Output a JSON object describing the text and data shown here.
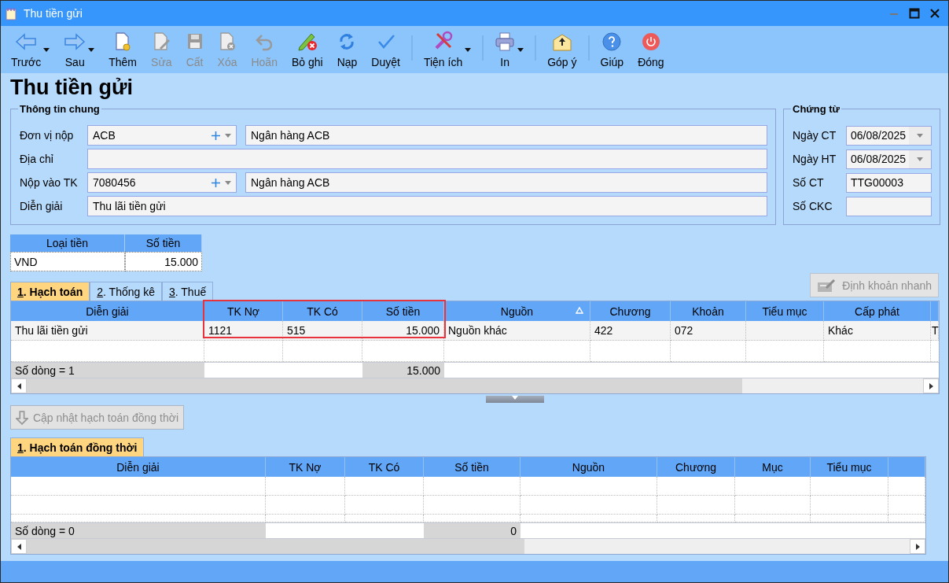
{
  "window": {
    "title": "Thu tiền gửi"
  },
  "toolbar": [
    {
      "kind": "button",
      "label": "Trước",
      "disabled": false,
      "dropdown": true
    },
    {
      "kind": "button",
      "label": "Sau",
      "disabled": false,
      "dropdown": true
    },
    {
      "kind": "button",
      "label": "Thêm",
      "disabled": false,
      "dropdown": false
    },
    {
      "kind": "button",
      "label": "Sửa",
      "disabled": true,
      "dropdown": false
    },
    {
      "kind": "button",
      "label": "Cất",
      "disabled": true,
      "dropdown": false
    },
    {
      "kind": "button",
      "label": "Xóa",
      "disabled": true,
      "dropdown": false
    },
    {
      "kind": "button",
      "label": "Hoãn",
      "disabled": true,
      "dropdown": false
    },
    {
      "kind": "button",
      "label": "Bỏ ghi",
      "disabled": false,
      "dropdown": false
    },
    {
      "kind": "button",
      "label": "Nạp",
      "disabled": false,
      "dropdown": false
    },
    {
      "kind": "button",
      "label": "Duyệt",
      "disabled": false,
      "dropdown": false
    },
    {
      "kind": "separator"
    },
    {
      "kind": "button",
      "label": "Tiện ích",
      "disabled": false,
      "dropdown": true
    },
    {
      "kind": "separator"
    },
    {
      "kind": "button",
      "label": "In",
      "disabled": false,
      "dropdown": true
    },
    {
      "kind": "separator"
    },
    {
      "kind": "button",
      "label": "Góp ý",
      "disabled": false,
      "dropdown": false
    },
    {
      "kind": "separator"
    },
    {
      "kind": "button",
      "label": "Giúp",
      "disabled": false,
      "dropdown": false
    },
    {
      "kind": "button",
      "label": "Đóng",
      "disabled": false,
      "dropdown": false
    }
  ],
  "heading": "Thu tiền gửi",
  "general_info": {
    "legend": "Thông tin chung",
    "fields": [
      {
        "kind": "combo",
        "label": "Đơn vị nộp",
        "value": "ACB",
        "name": "Ngân hàng ACB"
      },
      {
        "kind": "text",
        "label": "Địa chỉ"
      },
      {
        "kind": "combo",
        "label": "Nộp vào TK",
        "value": "7080456",
        "name": "Ngân hàng ACB"
      },
      {
        "kind": "text",
        "label": "Diễn giải",
        "value": "Thu lãi tiền gửi"
      }
    ]
  },
  "voucher": {
    "legend": "Chứng từ",
    "fields": [
      {
        "kind": "date",
        "label": "Ngày CT",
        "value": "06/08/2025"
      },
      {
        "kind": "date",
        "label": "Ngày HT",
        "value": "06/08/2025"
      },
      {
        "kind": "text",
        "label": "Số CT",
        "value": "TTG00003"
      },
      {
        "kind": "text",
        "label": "Số CKC"
      }
    ]
  },
  "currency_table": {
    "columns": [
      "Loại tiền",
      "Số tiền"
    ],
    "rows": [
      [
        "VND",
        "15.000"
      ]
    ]
  },
  "quick_entry_button": {
    "label": "Định khoản nhanh",
    "disabled": true
  },
  "tabs": [
    {
      "label": "1. Hạch toán",
      "selected": true
    },
    {
      "label": "2. Thống kê",
      "selected": false
    },
    {
      "label": "3. Thuế",
      "selected": false
    }
  ],
  "entries_grid": {
    "columns": [
      {
        "title": "Diễn giải",
        "highlighted": false,
        "sorted": false
      },
      {
        "title": "TK Nợ",
        "highlighted": true,
        "sorted": false
      },
      {
        "title": "TK Có",
        "highlighted": true,
        "sorted": false
      },
      {
        "title": "Số tiền",
        "highlighted": true,
        "sorted": false
      },
      {
        "title": "Nguồn",
        "highlighted": false,
        "sorted": true
      },
      {
        "title": "Chương",
        "highlighted": false,
        "sorted": false
      },
      {
        "title": "Khoản",
        "highlighted": false,
        "sorted": false
      },
      {
        "title": "Tiểu mục",
        "highlighted": false,
        "sorted": false
      },
      {
        "title": "Cấp phát",
        "highlighted": false,
        "sorted": false
      },
      {
        "highlighted": false,
        "sorted": false
      }
    ],
    "rows": [
      [
        "Thu lãi tiền gửi",
        "1121",
        "515",
        "15.000",
        "Nguồn khác",
        "422",
        "072",
        null,
        "Khác",
        "T"
      ]
    ],
    "footer": {
      "row_count": "Số dòng = 1",
      "total": "15.000"
    }
  },
  "update_button": {
    "label": "Cập nhật hạch toán đồng thời",
    "disabled": true
  },
  "simultaneous_tabs": [
    {
      "label": "1. Hạch toán đồng thời",
      "selected": true
    }
  ],
  "simultaneous_grid": {
    "columns": [
      {
        "title": "Diễn giải"
      },
      {
        "title": "TK Nợ"
      },
      {
        "title": "TK Có"
      },
      {
        "title": "Số tiền"
      },
      {
        "title": "Nguồn"
      },
      {
        "title": "Chương"
      },
      {
        "title": "Mục"
      },
      {
        "title": "Tiểu mục"
      },
      {}
    ],
    "footer": {
      "row_count": "Số dòng = 0",
      "total": "0"
    }
  }
}
